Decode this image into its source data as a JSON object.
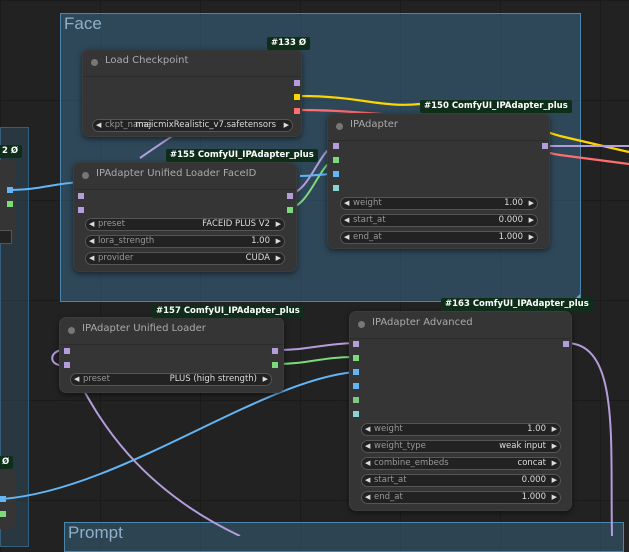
{
  "groups": {
    "face": {
      "title": "Face"
    },
    "prompt": {
      "title": "Prompt"
    }
  },
  "colors": {
    "model": "#b39ddb",
    "clip": "#ffd500",
    "vae": "#ff6e6e",
    "ipadapter": "#7cd97c",
    "image": "#64b5f6",
    "mask": "#81c784",
    "insightface": "#8bd2d2",
    "group_face": "#3f789e",
    "badge_bg": "#0f2e1a"
  },
  "nodes": {
    "load_checkpoint": {
      "badge": "#133 Ø",
      "title": "Load Checkpoint",
      "widgets": [
        {
          "name": "ckpt_name",
          "value": "majicmixRealistic_v7.safetensors"
        }
      ]
    },
    "ipadapter": {
      "badge": "#150 ComfyUI_IPAdapter_plus",
      "title": "IPAdapter",
      "widgets": [
        {
          "name": "weight",
          "value": "1.00"
        },
        {
          "name": "start_at",
          "value": "0.000"
        },
        {
          "name": "end_at",
          "value": "1.000"
        }
      ]
    },
    "unified_loader_faceid": {
      "badge": "#155 ComfyUI_IPAdapter_plus",
      "title": "IPAdapter Unified Loader FaceID",
      "widgets": [
        {
          "name": "preset",
          "value": "FACEID PLUS V2"
        },
        {
          "name": "lora_strength",
          "value": "1.00"
        },
        {
          "name": "provider",
          "value": "CUDA"
        }
      ]
    },
    "unified_loader": {
      "badge": "#157 ComfyUI_IPAdapter_plus",
      "title": "IPAdapter Unified Loader",
      "widgets": [
        {
          "name": "preset",
          "value": "PLUS (high strength)"
        }
      ]
    },
    "ipadapter_advanced": {
      "badge": "#163 ComfyUI_IPAdapter_plus",
      "title": "IPAdapter Advanced",
      "widgets": [
        {
          "name": "weight",
          "value": "1.00"
        },
        {
          "name": "weight_type",
          "value": "weak input"
        },
        {
          "name": "combine_embeds",
          "value": "concat"
        },
        {
          "name": "start_at",
          "value": "0.000"
        },
        {
          "name": "end_at",
          "value": "1.000"
        }
      ]
    },
    "left_partial_top": {
      "badge": "2 Ø"
    },
    "left_partial_bottom": {
      "badge": "Ø"
    }
  }
}
